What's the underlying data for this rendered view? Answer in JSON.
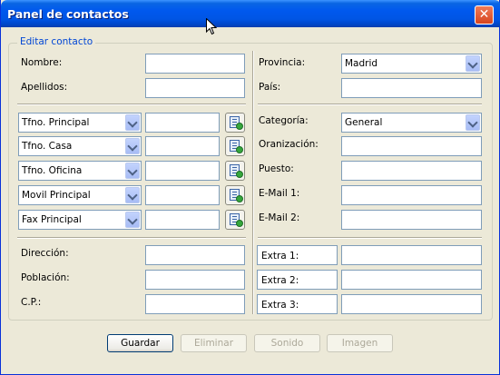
{
  "window": {
    "title": "Panel de contactos",
    "close_glyph": "✕"
  },
  "group": {
    "legend": "Editar contacto"
  },
  "left": {
    "nombre_label": "Nombre:",
    "apellidos_label": "Apellidos:",
    "phones": [
      "Tfno. Principal",
      "Tfno. Casa",
      "Tfno. Oficina",
      "Movil Principal",
      "Fax Principal"
    ],
    "direccion_label": "Dirección:",
    "poblacion_label": "Población:",
    "cp_label": "C.P.:"
  },
  "right": {
    "provincia_label": "Provincia:",
    "provincia_value": "Madrid",
    "pais_label": "País:",
    "categoria_label": "Categoría:",
    "categoria_value": "General",
    "organizacion_label": "Oranización:",
    "puesto_label": "Puesto:",
    "email1_label": "E-Mail 1:",
    "email2_label": "E-Mail 2:",
    "extras": [
      "Extra 1:",
      "Extra 2:",
      "Extra 3:"
    ]
  },
  "buttons": {
    "guardar": "Guardar",
    "eliminar": "Eliminar",
    "sonido": "Sonido",
    "imagen": "Imagen"
  },
  "icons": {
    "close": "close-icon",
    "phone_action": "contact-card-icon",
    "dropdown": "chevron-down-icon"
  }
}
